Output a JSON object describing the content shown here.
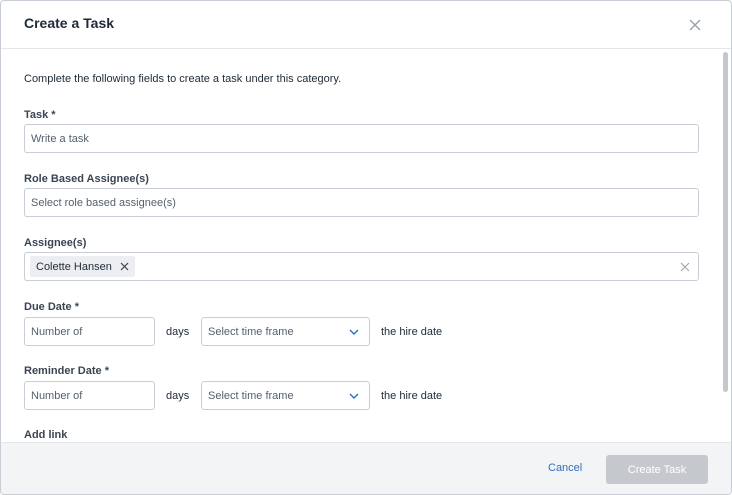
{
  "modal": {
    "title": "Create a Task",
    "intro": "Complete the following fields to create a task under this category."
  },
  "task": {
    "label": "Task *",
    "placeholder": "Write a task"
  },
  "role_assignees": {
    "label": "Role Based Assignee(s)",
    "placeholder": "Select role based assignee(s)"
  },
  "assignees": {
    "label": "Assignee(s)",
    "selected": [
      "Colette Hansen"
    ]
  },
  "due_date": {
    "label": "Due Date *",
    "number_placeholder": "Number of",
    "unit": "days",
    "timeframe_placeholder": "Select time frame",
    "suffix": "the hire date"
  },
  "reminder_date": {
    "label": "Reminder Date *",
    "number_placeholder": "Number of",
    "unit": "days",
    "timeframe_placeholder": "Select time frame",
    "suffix": "the hire date"
  },
  "add_link": {
    "label": "Add link"
  },
  "footer": {
    "cancel_label": "Cancel",
    "create_label": "Create Task"
  },
  "colors": {
    "accent_link": "#2f6fbf",
    "disabled_button": "#c5c9ce",
    "footer_bg": "#f3f4f6"
  },
  "icons": {
    "close": "close-icon",
    "chip_remove": "close-small-icon",
    "clear": "close-icon",
    "dropdown": "chevron-down-icon"
  }
}
